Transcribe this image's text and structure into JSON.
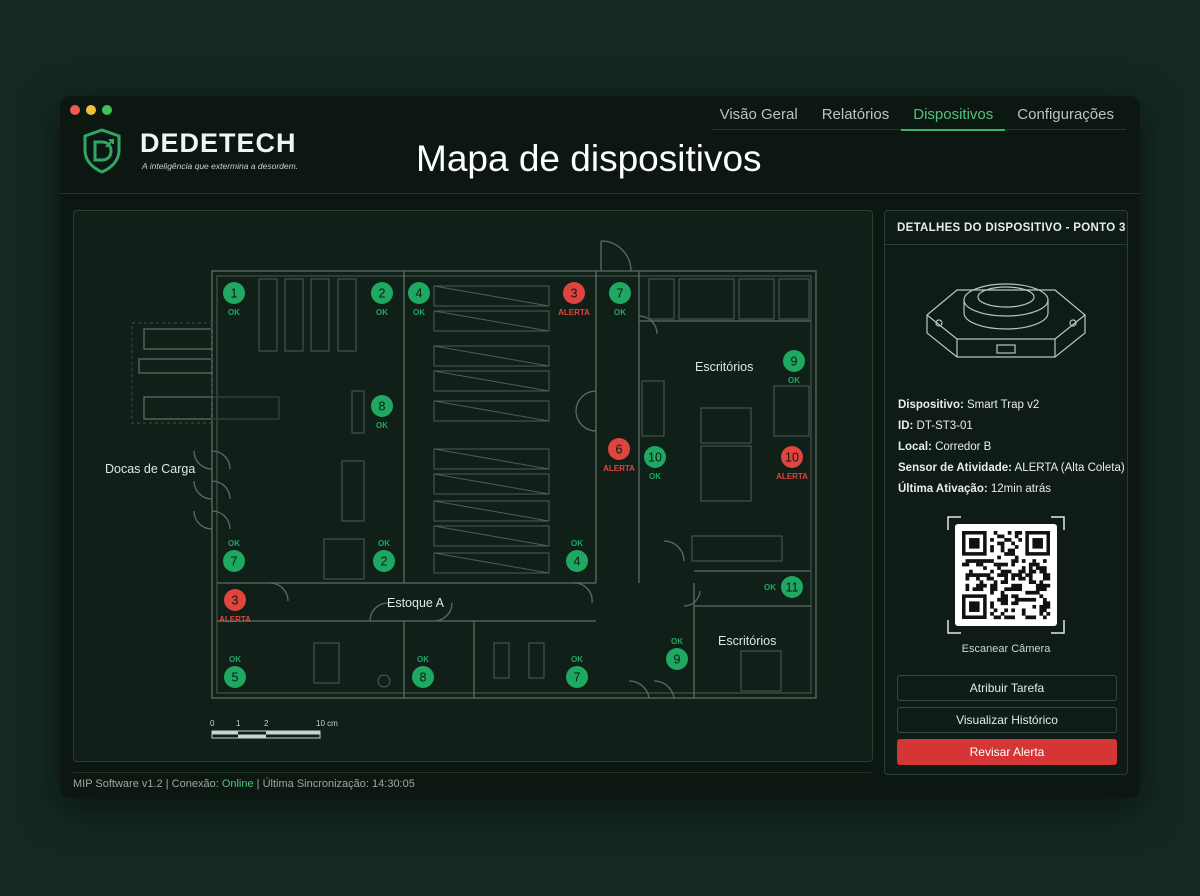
{
  "brand": {
    "name": "DEDETECH",
    "tagline": "A inteligência que extermina a desordem."
  },
  "page_title": "Mapa de dispositivos",
  "nav": {
    "tabs": [
      "Visão Geral",
      "Relatórios",
      "Dispositivos",
      "Configurações"
    ],
    "active": "Dispositivos"
  },
  "map": {
    "areas": [
      "Docas de Carga",
      "Estoque A",
      "Escritórios",
      "Escritórios"
    ],
    "scale": {
      "labels": [
        "0",
        "1",
        "2",
        "10 cm"
      ]
    },
    "devices": [
      {
        "id": "1",
        "status": "OK"
      },
      {
        "id": "2",
        "status": "OK"
      },
      {
        "id": "4",
        "status": "OK"
      },
      {
        "id": "3",
        "status": "ALERTA"
      },
      {
        "id": "7",
        "status": "OK"
      },
      {
        "id": "9",
        "status": "OK"
      },
      {
        "id": "8",
        "status": "OK"
      },
      {
        "id": "6",
        "status": "ALERTA"
      },
      {
        "id": "10",
        "status": "OK"
      },
      {
        "id": "10",
        "status": "ALERTA"
      },
      {
        "id": "7",
        "status": "OK"
      },
      {
        "id": "2",
        "status": "OK"
      },
      {
        "id": "4",
        "status": "OK"
      },
      {
        "id": "3",
        "status": "ALERTA"
      },
      {
        "id": "11",
        "status": "OK"
      },
      {
        "id": "9",
        "status": "OK"
      },
      {
        "id": "5",
        "status": "OK"
      },
      {
        "id": "8",
        "status": "OK"
      },
      {
        "id": "7",
        "status": "OK"
      }
    ]
  },
  "details": {
    "title": "DETALHES DO DISPOSITIVO - PONTO 3",
    "device_label": "Dispositivo:",
    "device_value": "Smart Trap v2",
    "id_label": "ID:",
    "id_value": "DT-ST3-01",
    "local_label": "Local:",
    "local_value": "Corredor B",
    "sensor_label": "Sensor de Atividade:",
    "sensor_value": "ALERTA (Alta Coleta)",
    "last_label": "Última Ativação:",
    "last_value": "12min atrás",
    "qr_label": "Escanear Câmera"
  },
  "buttons": {
    "assign": "Atribuir Tarefa",
    "history": "Visualizar Histórico",
    "review": "Revisar Alerta"
  },
  "status_bar": {
    "version": "MIP Software v1.2",
    "conn_label": "Conexão:",
    "conn_value": "Online",
    "sync_label": "Última Sincronização:",
    "sync_value": "14:30:05"
  },
  "colors": {
    "ok": "#1fa861",
    "alert": "#e0443e",
    "accent": "#3fb36c"
  }
}
